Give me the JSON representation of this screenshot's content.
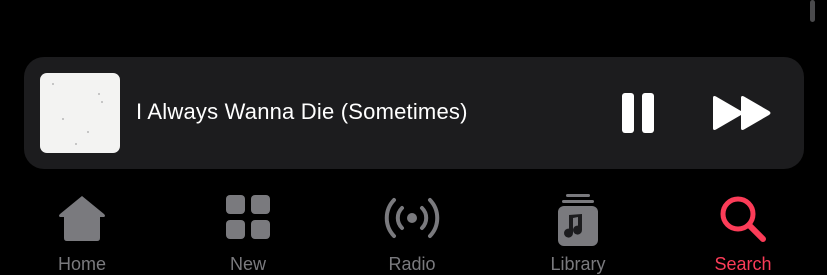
{
  "now_playing": {
    "title": "I Always Wanna Die (Sometimes)",
    "artwork": "album-artwork",
    "pause_icon": "pause-icon",
    "forward_icon": "skip-forward-icon"
  },
  "tab_bar": {
    "active": "Search",
    "tabs": [
      {
        "label": "Home",
        "icon": "house-icon"
      },
      {
        "label": "New",
        "icon": "grid-icon"
      },
      {
        "label": "Radio",
        "icon": "broadcast-icon"
      },
      {
        "label": "Library",
        "icon": "music-library-icon"
      },
      {
        "label": "Search",
        "icon": "search-icon"
      }
    ]
  },
  "colors": {
    "accent": "#fb3c58",
    "inactive": "#7a7a7e",
    "player_background": "#1c1c1e",
    "background": "#000000"
  }
}
